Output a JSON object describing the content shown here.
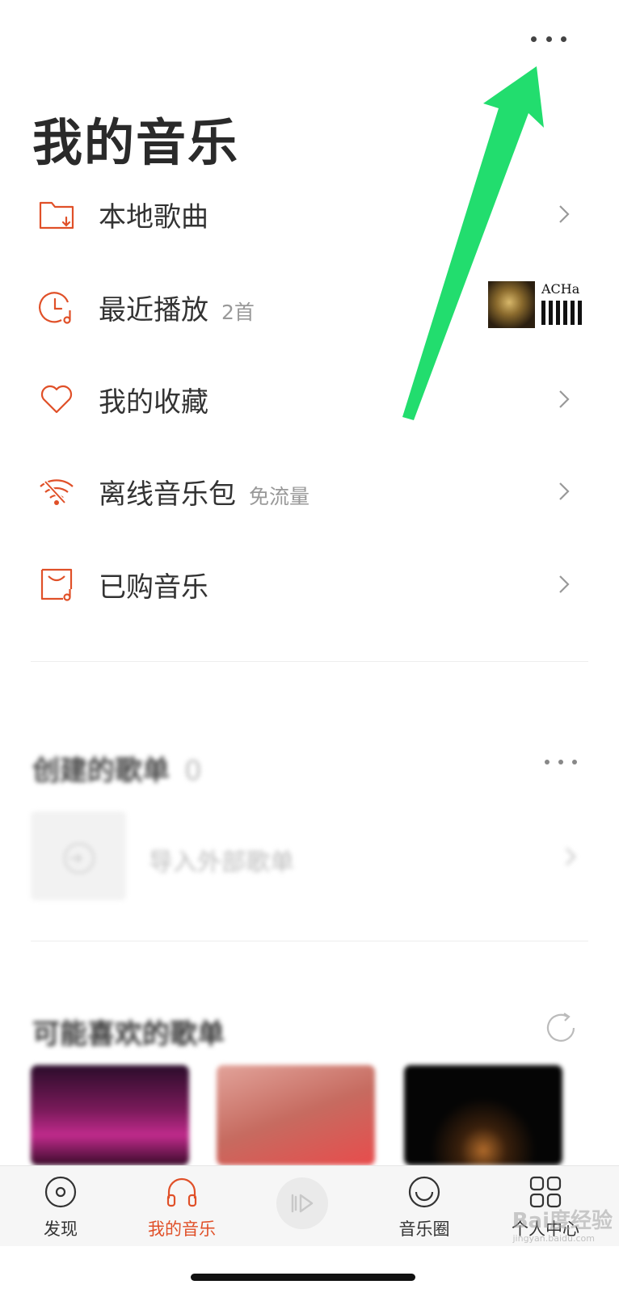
{
  "header": {
    "title": "我的音乐",
    "more_icon": "more-dots-icon"
  },
  "menu": [
    {
      "label": "本地歌曲",
      "sub": "",
      "icon": "folder-download-icon"
    },
    {
      "label": "最近播放",
      "sub": "2首",
      "icon": "clock-music-icon"
    },
    {
      "label": "我的收藏",
      "sub": "",
      "icon": "heart-icon"
    },
    {
      "label": "离线音乐包",
      "sub": "免流量",
      "icon": "wifi-offline-icon"
    },
    {
      "label": "已购音乐",
      "sub": "",
      "icon": "purchased-bag-icon"
    }
  ],
  "recent_thumb_text": "ACHa",
  "created_playlists": {
    "title": "创建的歌单",
    "count": "0",
    "import_label": "导入外部歌单"
  },
  "recommended": {
    "title": "可能喜欢的歌单"
  },
  "tabbar": {
    "tabs": [
      {
        "label": "发现",
        "icon": "disc-icon"
      },
      {
        "label": "我的音乐",
        "icon": "headphones-icon",
        "active": true
      },
      {
        "label": "音乐圈",
        "icon": "smile-circle-icon"
      },
      {
        "label": "个人中心",
        "icon": "grid-icon"
      }
    ],
    "player_icon": "player-play-icon"
  },
  "watermark": {
    "text": "Bai度经验",
    "sub": "jingyan.baidu.com"
  },
  "colors": {
    "accent": "#e05028",
    "arrow": "#22dd6e"
  }
}
